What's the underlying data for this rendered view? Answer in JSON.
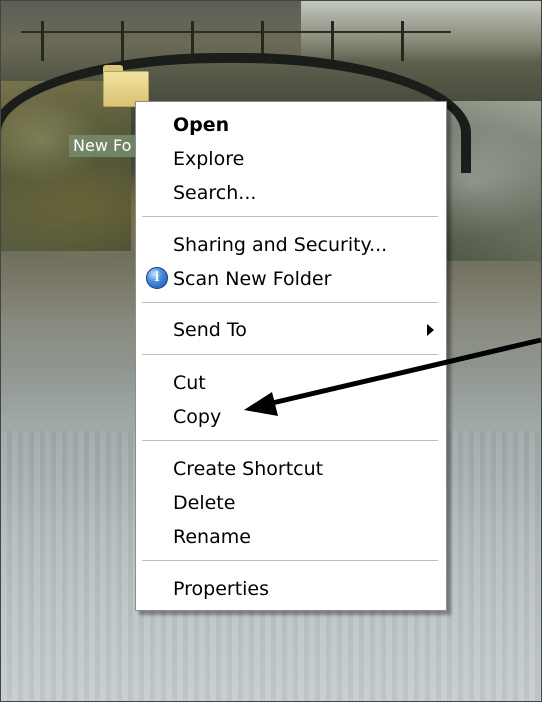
{
  "desktop": {
    "folder_label": "New Fo"
  },
  "context_menu": {
    "items": [
      {
        "label": "Open",
        "bold": true
      },
      {
        "label": "Explore"
      },
      {
        "label": "Search..."
      },
      {
        "label": "Sharing and Security..."
      },
      {
        "label": "Scan New Folder",
        "icon": "scan-shield-icon"
      },
      {
        "label": "Send To",
        "submenu": true
      },
      {
        "label": "Cut"
      },
      {
        "label": "Copy"
      },
      {
        "label": "Create Shortcut"
      },
      {
        "label": "Delete"
      },
      {
        "label": "Rename"
      },
      {
        "label": "Properties"
      }
    ],
    "scan_icon_glyph": "i"
  },
  "annotation": {
    "points_to": "Copy",
    "color": "#000000"
  },
  "colors": {
    "menu_background": "#ffffff",
    "menu_separator": "#bdbdbd",
    "label_highlight": "#788c6e"
  }
}
